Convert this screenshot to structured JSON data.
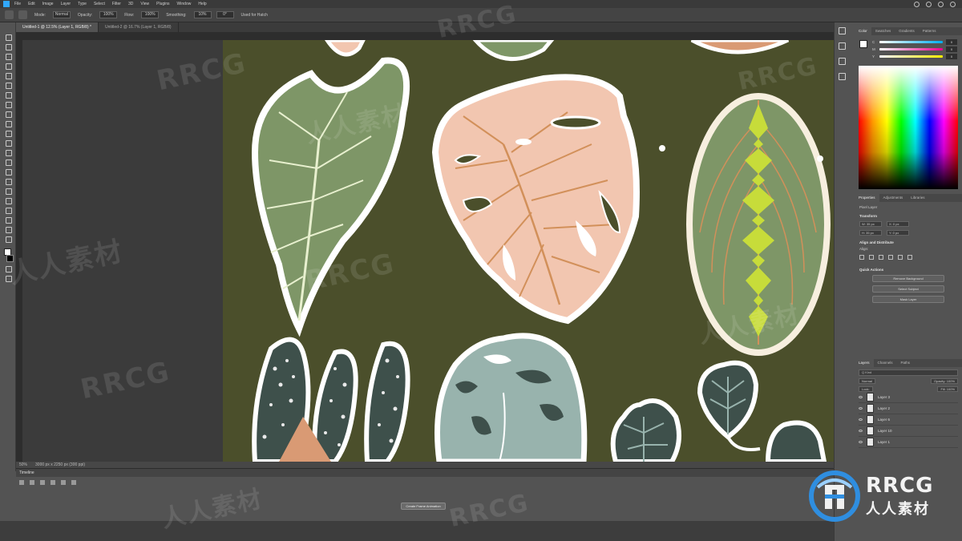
{
  "app": {
    "menu": [
      "File",
      "Edit",
      "Image",
      "Layer",
      "Type",
      "Select",
      "Filter",
      "3D",
      "View",
      "Plugins",
      "Window",
      "Help"
    ]
  },
  "options_bar": {
    "mode_label": "Mode:",
    "mode_value": "Normal",
    "opacity_label": "Opacity:",
    "opacity_value": "100%",
    "flow_label": "Flow:",
    "flow_value": "100%",
    "smoothing_label": "Smoothing:",
    "smoothing_value": "10%",
    "angle_value": "0°",
    "extra_label": "Used for Hatch"
  },
  "doc_tabs": [
    {
      "label": "Untitled-1 @ 12.5% (Layer 1, RGB/8) *",
      "active": true
    },
    {
      "label": "Untitled-2 @ 16.7% (Layer 1, RGB/8)",
      "active": false
    }
  ],
  "status": {
    "zoom": "50%",
    "doc_size": "3000 px x 2250 px (300 ppi)"
  },
  "timeline": {
    "title": "Timeline",
    "create_button": "Create Frame Animation"
  },
  "color_panel": {
    "tabs": [
      "Color",
      "Swatches",
      "Gradients",
      "Patterns"
    ],
    "sliders": [
      {
        "label": "C",
        "value": "0"
      },
      {
        "label": "M",
        "value": "0"
      },
      {
        "label": "Y",
        "value": "0"
      }
    ]
  },
  "properties_panel": {
    "tabs": [
      "Properties",
      "Adjustments",
      "Libraries"
    ],
    "pixel_layer": "Pixel Layer",
    "transform": "Transform",
    "w_value": "W: 35 px",
    "h_value": "H: 35 px",
    "x_value": "X: 0 px",
    "y_value": "Y: 0 px",
    "align": "Align and Distribute",
    "align_label": "Align:",
    "quick_actions": "Quick Actions",
    "qa_buttons": [
      "Remove Background",
      "Select Subject",
      "Mask Layer"
    ]
  },
  "layers_panel": {
    "tabs": [
      "Layers",
      "Channels",
      "Paths"
    ],
    "kind": "Q Kind",
    "blend_mode": "Normal",
    "opacity": "Opacity: 100%",
    "lock": "Lock:",
    "fill": "Fill: 100%",
    "layers": [
      "Layer 3",
      "Layer 2",
      "Layer 6",
      "Layer 10",
      "Layer 1"
    ]
  },
  "brand": {
    "title": "RRCG",
    "subtitle": "人人素材"
  },
  "watermarks": [
    "RRCG",
    "人人素材"
  ],
  "colors": {
    "canvas_bg": "#4b4f2b",
    "leaf_green": "#7e9667",
    "leaf_pink": "#f2c6b0",
    "leaf_vein": "#d2905a",
    "leaf_teal": "#98b3ad",
    "leaf_dark": "#3e504b",
    "calathea_lime": "#c7dc3a"
  }
}
